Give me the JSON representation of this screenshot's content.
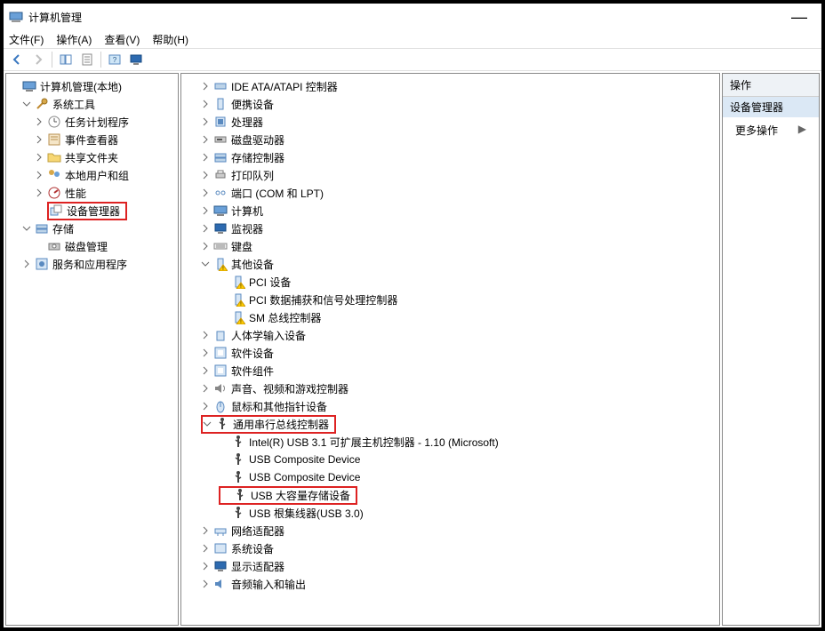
{
  "window": {
    "title": "计算机管理"
  },
  "menu": {
    "file": "文件(F)",
    "action": "操作(A)",
    "view": "查看(V)",
    "help": "帮助(H)"
  },
  "actions": {
    "header": "操作",
    "context": "设备管理器",
    "more": "更多操作"
  },
  "icons": {
    "computer": "<rect x='1' y='3' width='14' height='8' fill='#6aa0d8' stroke='#2b5a8a'/><rect x='4' y='12' width='8' height='2' fill='#888'/>",
    "tools": "<path d='M3 13 L9 7' stroke='#c08a30' stroke-width='2'/><circle cx='11' cy='5' r='3' fill='#d7a84a' stroke='#9a7020'/>",
    "clock": "<circle cx='8' cy='8' r='6' fill='#fff' stroke='#888'/><path d='M8 8 L8 4 M8 8 L11 8' stroke='#555'/>",
    "event": "<rect x='2' y='2' width='12' height='12' fill='#f5e6c8' stroke='#b89050'/><line x1='4' y1='5' x2='12' y2='5' stroke='#b89050'/><line x1='4' y1='8' x2='12' y2='8' stroke='#b89050'/>",
    "folder": "<path d='M1 4h5l2 2h7v7H1z' fill='#f7d774' stroke='#c0a040'/>",
    "users": "<circle cx='5' cy='5' r='3' fill='#d7a84a'/><circle cx='11' cy='7' r='3' fill='#6aa0d8'/>",
    "perf": "<circle cx='8' cy='8' r='6' fill='#fff' stroke='#b03030'/><path d='M8 8 L12 5' stroke='#b03030' stroke-width='2'/>",
    "device": "<rect x='2' y='5' width='8' height='8' fill='#d7e6f5' stroke='#5a8ac0'/><rect x='6' y='2' width='8' height='8' fill='#fff' stroke='#888'/>",
    "storage": "<rect x='2' y='4' width='12' height='4' fill='#bcd3e8' stroke='#5a8ac0'/><rect x='2' y='9' width='12' height='4' fill='#bcd3e8' stroke='#5a8ac0'/>",
    "disk": "<rect x='2' y='5' width='12' height='7' fill='#ccc' stroke='#777'/><circle cx='8' cy='8' r='2' fill='#fff' stroke='#777'/>",
    "services": "<rect x='2' y='2' width='12' height='12' fill='#d7e6f5' stroke='#5a8ac0'/><circle cx='8' cy='8' r='3' fill='#5a8ac0'/>",
    "ide": "<rect x='2' y='5' width='12' height='6' fill='#bcd3e8' stroke='#5a8ac0'/>",
    "portable": "<rect x='5' y='2' width='6' height='12' fill='#d7e6f5' stroke='#5a8ac0'/>",
    "cpu": "<rect x='3' y='3' width='10' height='10' fill='#d7e6f5' stroke='#5a8ac0'/><rect x='5' y='5' width='6' height='6' fill='#5a8ac0'/>",
    "drive": "<rect x='2' y='5' width='12' height='6' fill='#ccc' stroke='#777'/><rect x='4' y='7' width='6' height='2' fill='#555'/>",
    "printer": "<rect x='3' y='6' width='10' height='5' fill='#ccc' stroke='#777'/><rect x='5' y='3' width='6' height='3' fill='#fff' stroke='#777'/>",
    "port": "<circle cx='5' cy='8' r='2' fill='none' stroke='#5a8ac0'/><circle cx='11' cy='8' r='2' fill='none' stroke='#5a8ac0'/>",
    "monitor": "<rect x='2' y='3' width='12' height='8' fill='#2d6ab0' stroke='#174a80'/><rect x='5' y='12' width='6' height='2' fill='#888'/>",
    "keyboard": "<rect x='1' y='5' width='14' height='6' fill='#eee' stroke='#888'/><line x1='3' y1='7' x2='13' y2='7' stroke='#888'/><line x1='3' y1='9' x2='13' y2='9' stroke='#888'/>",
    "warn": "<rect x='5' y='2' width='6' height='12' fill='#d7e6f5' stroke='#5a8ac0'/><polygon points='11,9 16,16 6,16' fill='#fc0' stroke='#c90'/><text x='11' y='15' font-size='6' text-anchor='middle'>!</text>",
    "hid": "<rect x='4' y='4' width='8' height='10' fill='#d7e6f5' stroke='#5a8ac0'/>",
    "sw": "<rect x='2' y='2' width='12' height='12' fill='#d7e6f5' stroke='#5a8ac0'/><rect x='5' y='5' width='6' height='6' fill='#fff'/>",
    "sound": "<path d='M2 6h3l4-3v10l-4-3H2z' fill='#888'/><path d='M11 5c2 1 2 5 0 6' stroke='#888' fill='none'/>",
    "mouse": "<ellipse cx='8' cy='9' rx='4' ry='6' fill='#d7e6f5' stroke='#5a8ac0'/><line x1='8' y1='3' x2='8' y2='9' stroke='#5a8ac0'/>",
    "usb": "<circle cx='8' cy='3' r='2' fill='#444'/><line x1='8' y1='5' x2='8' y2='14' stroke='#444' stroke-width='2'/><path d='M8 8l-3-2 M8 10l3-2' stroke='#444' stroke-width='1.5' fill='none'/>",
    "net": "<rect x='2' y='6' width='12' height='5' fill='#d7e6f5' stroke='#5a8ac0'/><line x1='5' y1='11' x2='5' y2='14' stroke='#5a8ac0'/><line x1='11' y1='11' x2='11' y2='14' stroke='#5a8ac0'/>",
    "sys": "<rect x='2' y='3' width='12' height='10' fill='#d7e6f5' stroke='#5a8ac0'/>",
    "audio": "<path d='M2 6h3l4-3v10l-4-3H2z' fill='#5a8ac0'/>"
  },
  "leftTree": [
    {
      "ind": 0,
      "tw": "",
      "icon": "computer",
      "label": "计算机管理(本地)",
      "name": "nav-root"
    },
    {
      "ind": 1,
      "tw": "v",
      "icon": "tools",
      "label": "系统工具",
      "name": "nav-system-tools"
    },
    {
      "ind": 2,
      "tw": ">",
      "icon": "clock",
      "label": "任务计划程序",
      "name": "nav-task-scheduler"
    },
    {
      "ind": 2,
      "tw": ">",
      "icon": "event",
      "label": "事件查看器",
      "name": "nav-event-viewer"
    },
    {
      "ind": 2,
      "tw": ">",
      "icon": "folder",
      "label": "共享文件夹",
      "name": "nav-shared-folders"
    },
    {
      "ind": 2,
      "tw": ">",
      "icon": "users",
      "label": "本地用户和组",
      "name": "nav-local-users"
    },
    {
      "ind": 2,
      "tw": ">",
      "icon": "perf",
      "label": "性能",
      "name": "nav-performance"
    },
    {
      "ind": 2,
      "tw": "",
      "icon": "device",
      "label": "设备管理器",
      "name": "nav-device-manager",
      "hl": true
    },
    {
      "ind": 1,
      "tw": "v",
      "icon": "storage",
      "label": "存储",
      "name": "nav-storage"
    },
    {
      "ind": 2,
      "tw": "",
      "icon": "disk",
      "label": "磁盘管理",
      "name": "nav-disk-management"
    },
    {
      "ind": 1,
      "tw": ">",
      "icon": "services",
      "label": "服务和应用程序",
      "name": "nav-services-apps"
    }
  ],
  "midTree": [
    {
      "ind": 0,
      "tw": ">",
      "icon": "ide",
      "label": "IDE ATA/ATAPI 控制器",
      "name": "dev-ide"
    },
    {
      "ind": 0,
      "tw": ">",
      "icon": "portable",
      "label": "便携设备",
      "name": "dev-portable"
    },
    {
      "ind": 0,
      "tw": ">",
      "icon": "cpu",
      "label": "处理器",
      "name": "dev-processors"
    },
    {
      "ind": 0,
      "tw": ">",
      "icon": "drive",
      "label": "磁盘驱动器",
      "name": "dev-disk-drives"
    },
    {
      "ind": 0,
      "tw": ">",
      "icon": "storage",
      "label": "存储控制器",
      "name": "dev-storage-controllers"
    },
    {
      "ind": 0,
      "tw": ">",
      "icon": "printer",
      "label": "打印队列",
      "name": "dev-print-queues"
    },
    {
      "ind": 0,
      "tw": ">",
      "icon": "port",
      "label": "端口 (COM 和 LPT)",
      "name": "dev-ports"
    },
    {
      "ind": 0,
      "tw": ">",
      "icon": "computer",
      "label": "计算机",
      "name": "dev-computer"
    },
    {
      "ind": 0,
      "tw": ">",
      "icon": "monitor",
      "label": "监视器",
      "name": "dev-monitors"
    },
    {
      "ind": 0,
      "tw": ">",
      "icon": "keyboard",
      "label": "键盘",
      "name": "dev-keyboards"
    },
    {
      "ind": 0,
      "tw": "v",
      "icon": "warn",
      "label": "其他设备",
      "name": "dev-other"
    },
    {
      "ind": 1,
      "tw": "",
      "icon": "warn",
      "label": "PCI 设备",
      "name": "dev-other-pci"
    },
    {
      "ind": 1,
      "tw": "",
      "icon": "warn",
      "label": "PCI 数据捕获和信号处理控制器",
      "name": "dev-other-pci-signal"
    },
    {
      "ind": 1,
      "tw": "",
      "icon": "warn",
      "label": "SM 总线控制器",
      "name": "dev-other-smbus"
    },
    {
      "ind": 0,
      "tw": ">",
      "icon": "hid",
      "label": "人体学输入设备",
      "name": "dev-hid"
    },
    {
      "ind": 0,
      "tw": ">",
      "icon": "sw",
      "label": "软件设备",
      "name": "dev-software"
    },
    {
      "ind": 0,
      "tw": ">",
      "icon": "sw",
      "label": "软件组件",
      "name": "dev-software-components"
    },
    {
      "ind": 0,
      "tw": ">",
      "icon": "sound",
      "label": "声音、视频和游戏控制器",
      "name": "dev-sound"
    },
    {
      "ind": 0,
      "tw": ">",
      "icon": "mouse",
      "label": "鼠标和其他指针设备",
      "name": "dev-mice"
    },
    {
      "ind": 0,
      "tw": "v",
      "icon": "usb",
      "label": "通用串行总线控制器",
      "name": "dev-usb",
      "hl": "row"
    },
    {
      "ind": 1,
      "tw": "",
      "icon": "usb",
      "label": "Intel(R) USB 3.1 可扩展主机控制器 - 1.10 (Microsoft)",
      "name": "dev-usb-host"
    },
    {
      "ind": 1,
      "tw": "",
      "icon": "usb",
      "label": "USB Composite Device",
      "name": "dev-usb-composite-1"
    },
    {
      "ind": 1,
      "tw": "",
      "icon": "usb",
      "label": "USB Composite Device",
      "name": "dev-usb-composite-2"
    },
    {
      "ind": 1,
      "tw": "",
      "icon": "usb",
      "label": "USB 大容量存储设备",
      "name": "dev-usb-mass-storage",
      "hl": "row"
    },
    {
      "ind": 1,
      "tw": "",
      "icon": "usb",
      "label": "USB 根集线器(USB 3.0)",
      "name": "dev-usb-root-hub"
    },
    {
      "ind": 0,
      "tw": ">",
      "icon": "net",
      "label": "网络适配器",
      "name": "dev-network"
    },
    {
      "ind": 0,
      "tw": ">",
      "icon": "sys",
      "label": "系统设备",
      "name": "dev-system"
    },
    {
      "ind": 0,
      "tw": ">",
      "icon": "monitor",
      "label": "显示适配器",
      "name": "dev-display"
    },
    {
      "ind": 0,
      "tw": ">",
      "icon": "audio",
      "label": "音频输入和输出",
      "name": "dev-audio-io"
    }
  ]
}
